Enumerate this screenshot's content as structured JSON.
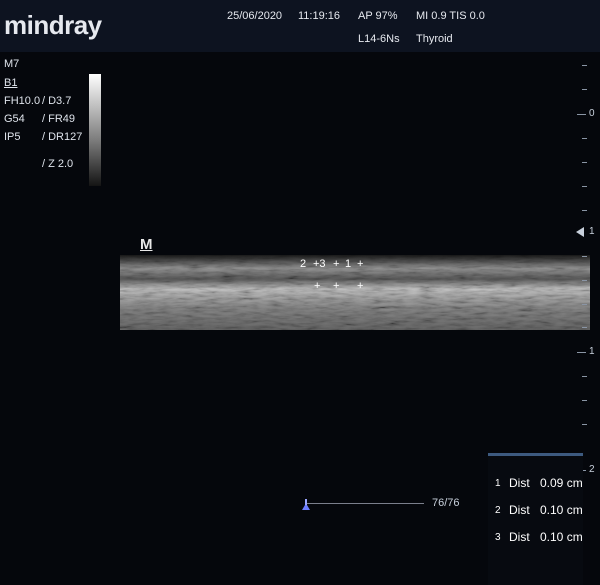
{
  "header": {
    "brand": "mindray",
    "date": "25/06/2020",
    "time": "11:19:16",
    "acoustic_power": "AP  97%",
    "mi_tis": "MI 0.9  TIS 0.0",
    "probe": "L14-6Ns",
    "preset": "Thyroid"
  },
  "params": {
    "mode": "M7",
    "mode_sub": "B1",
    "fh": "FH10.0",
    "depth": "/ D3.7",
    "gain": "G54",
    "frame_rate": "/ FR49",
    "ip": "IP5",
    "dynamic_range": "/ DR127",
    "zoom": "/ Z 2.0"
  },
  "image": {
    "marker": "M",
    "calipers": [
      "2",
      "+3",
      "+",
      "1",
      "+"
    ]
  },
  "depth_scale": {
    "label_0": "0",
    "label_1": "1",
    "label_1b": "1",
    "label_2": "2"
  },
  "cine": {
    "count": "76/76"
  },
  "measurements": [
    {
      "index": "1",
      "label": "Dist",
      "value": "0.09 cm"
    },
    {
      "index": "2",
      "label": "Dist",
      "value": "0.10 cm"
    },
    {
      "index": "3",
      "label": "Dist",
      "value": "0.10 cm"
    }
  ],
  "colors": {
    "background": "#05070c",
    "header": "#0d1320",
    "accent": "#3d5a80"
  }
}
